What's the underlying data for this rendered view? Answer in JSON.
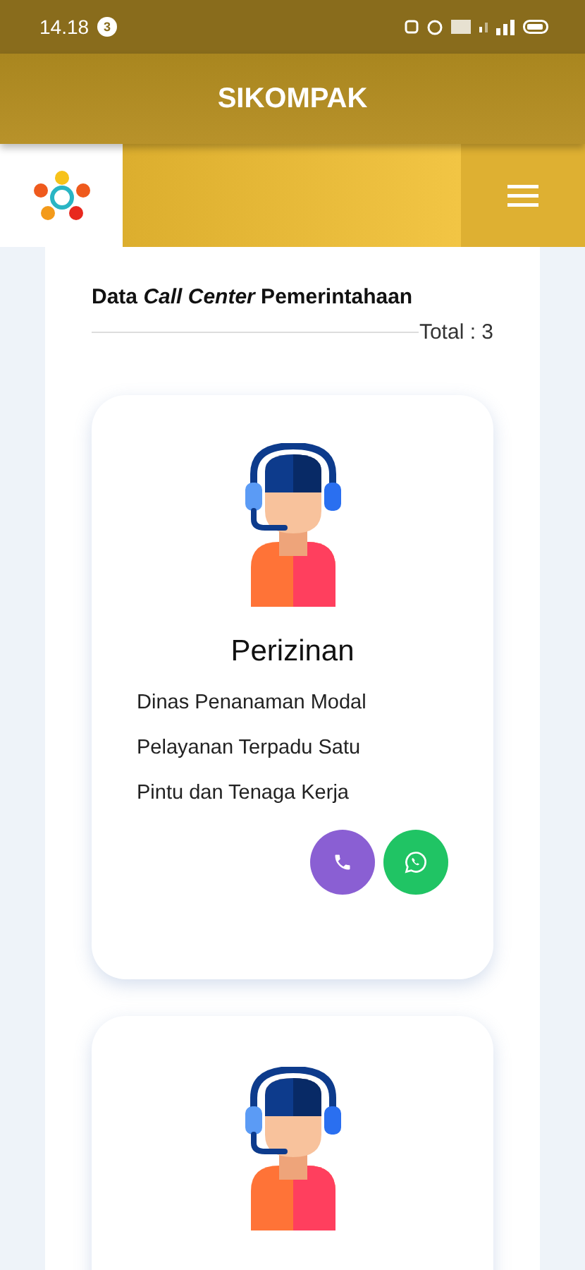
{
  "status_bar": {
    "time": "14.18",
    "notification_count": "3"
  },
  "app_bar": {
    "title": "SIKOMPAK"
  },
  "section": {
    "title": "Data *Call Center* Pemerintahaan",
    "total": "Total : 3"
  },
  "cards": [
    {
      "kind": "contact",
      "title": "Perizinan",
      "description": "Dinas Penanaman Modal Pelayanan Terpadu Satu Pintu dan Tenaga Kerja",
      "buttons": [
        {
          "kind": "call"
        },
        {
          "kind": "whatsapp"
        }
      ]
    },
    {
      "kind": "contact"
    }
  ]
}
